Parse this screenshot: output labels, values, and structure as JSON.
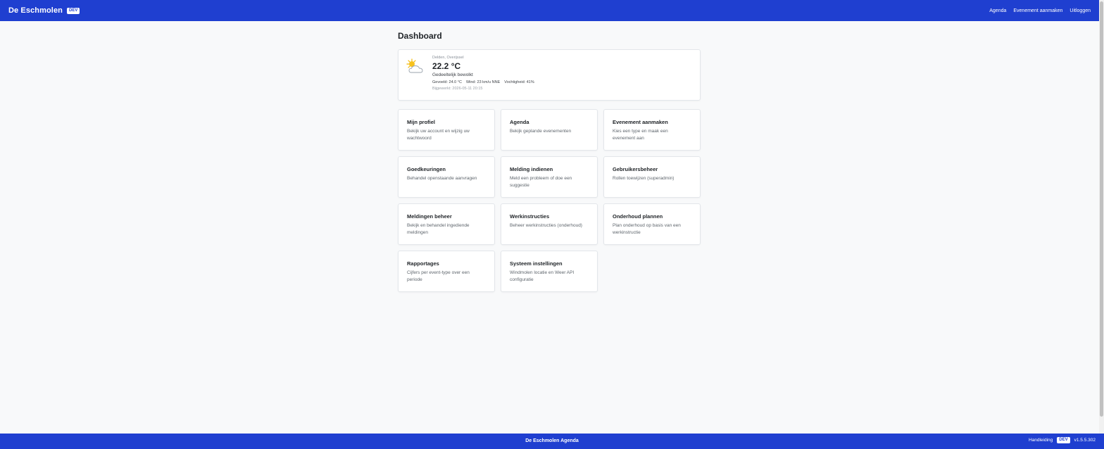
{
  "header": {
    "brand": "De Eschmolen",
    "env_badge": "DEV",
    "nav": [
      "Agenda",
      "Evenement aanmaken",
      "Uitloggen"
    ]
  },
  "page": {
    "title": "Dashboard"
  },
  "weather": {
    "icon": "partly-cloudy-icon",
    "location": "Delden, Overijssel",
    "temperature": "22.2 °C",
    "description": "Gedeeltelijk bewolkt",
    "feels_like": "Gevoeld: 24.0 °C",
    "wind": "Wind: 23 km/u NNE",
    "humidity": "Vochtigheid: 41%",
    "updated": "Bijgewerkt: 2026-05-11 20:15"
  },
  "tiles": [
    {
      "title": "Mijn profiel",
      "desc": "Bekijk uw account en wijzig uw wachtwoord"
    },
    {
      "title": "Agenda",
      "desc": "Bekijk geplande evenementen"
    },
    {
      "title": "Evenement aanmaken",
      "desc": "Kies een type en maak een evenement aan"
    },
    {
      "title": "Goedkeuringen",
      "desc": "Behandel openstaande aanvragen"
    },
    {
      "title": "Melding indienen",
      "desc": "Meld een probleem of doe een suggestie"
    },
    {
      "title": "Gebruikersbeheer",
      "desc": "Rollen toewijzen (superadmin)"
    },
    {
      "title": "Meldingen beheer",
      "desc": "Bekijk en behandel ingediende meldingen"
    },
    {
      "title": "Werkinstructies",
      "desc": "Beheer werkinstructies (onderhoud)"
    },
    {
      "title": "Onderhoud plannen",
      "desc": "Plan onderhoud op basis van een werkinstructie"
    },
    {
      "title": "Rapportages",
      "desc": "Cijfers per event-type over een periode"
    },
    {
      "title": "Systeem instellingen",
      "desc": "Windmolen locatie en Weer API configuratie"
    }
  ],
  "footer": {
    "title": "De Eschmolen Agenda",
    "manual": "Handleiding",
    "env_badge": "DEV",
    "version": "v1.5.5.302"
  },
  "colors": {
    "brand_blue": "#1f3fd0",
    "page_bg": "#f8f9fa"
  }
}
